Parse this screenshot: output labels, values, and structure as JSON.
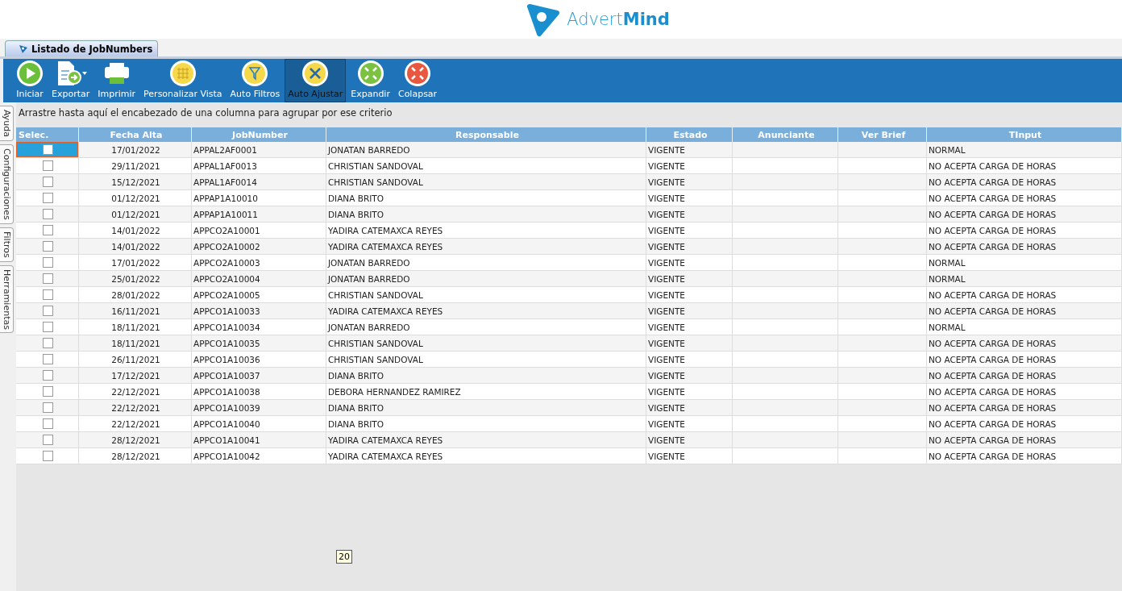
{
  "logo": {
    "text": "Advert**Mind**"
  },
  "document_tab": {
    "label": "Listado de JobNumbers",
    "selected": true
  },
  "toolbar": [
    {
      "kind": "play",
      "label": "Iniciar",
      "active": false
    },
    {
      "kind": "export",
      "label": "Exportar",
      "active": false,
      "dropdown": true
    },
    {
      "kind": "print",
      "label": "Imprimir",
      "active": false
    },
    {
      "kind": "grid",
      "label": "Personalizar Vista",
      "active": false
    },
    {
      "kind": "filter",
      "label": "Auto Filtros",
      "active": false
    },
    {
      "kind": "tools",
      "label": "Auto Ajustar",
      "active": true
    },
    {
      "kind": "expand",
      "label": "Expandir",
      "active": false
    },
    {
      "kind": "collapse",
      "label": "Colapsar",
      "active": false
    }
  ],
  "side_tabs": [
    "Ayuda",
    "Configuraciones",
    "Filtros",
    "Herramientas"
  ],
  "group_hint": "Arrastre hasta aquí el encabezado de una columna para agrupar por ese criterio",
  "table": {
    "columns": [
      "Selec.",
      "Fecha Alta",
      "JobNumber",
      "Responsable",
      "Estado",
      "Anunciante",
      "Ver Brief",
      "TInput"
    ],
    "rows": [
      {
        "selected": true,
        "checked": false,
        "cells": [
          "",
          "17/01/2022",
          "APPAL2AF0001",
          "JONATAN BARREDO",
          "VIGENTE",
          "",
          "",
          "NORMAL"
        ]
      },
      {
        "selected": false,
        "checked": false,
        "cells": [
          "",
          "29/11/2021",
          "APPAL1AF0013",
          "CHRISTIAN SANDOVAL",
          "VIGENTE",
          "",
          "",
          "NO ACEPTA CARGA DE HORAS"
        ]
      },
      {
        "selected": false,
        "checked": false,
        "cells": [
          "",
          "15/12/2021",
          "APPAL1AF0014",
          "CHRISTIAN SANDOVAL",
          "VIGENTE",
          "",
          "",
          "NO ACEPTA CARGA DE HORAS"
        ]
      },
      {
        "selected": false,
        "checked": false,
        "cells": [
          "",
          "01/12/2021",
          "APPAP1A10010",
          "DIANA BRITO",
          "VIGENTE",
          "",
          "",
          "NO ACEPTA CARGA DE HORAS"
        ]
      },
      {
        "selected": false,
        "checked": false,
        "cells": [
          "",
          "01/12/2021",
          "APPAP1A10011",
          "DIANA BRITO",
          "VIGENTE",
          "",
          "",
          "NO ACEPTA CARGA DE HORAS"
        ]
      },
      {
        "selected": false,
        "checked": false,
        "cells": [
          "",
          "14/01/2022",
          "APPCO2A10001",
          "YADIRA CATEMAXCA REYES",
          "VIGENTE",
          "",
          "",
          "NO ACEPTA CARGA DE HORAS"
        ]
      },
      {
        "selected": false,
        "checked": false,
        "cells": [
          "",
          "14/01/2022",
          "APPCO2A10002",
          "YADIRA CATEMAXCA REYES",
          "VIGENTE",
          "",
          "",
          "NO ACEPTA CARGA DE HORAS"
        ]
      },
      {
        "selected": false,
        "checked": false,
        "cells": [
          "",
          "17/01/2022",
          "APPCO2A10003",
          "JONATAN BARREDO",
          "VIGENTE",
          "",
          "",
          "NORMAL"
        ]
      },
      {
        "selected": false,
        "checked": false,
        "cells": [
          "",
          "25/01/2022",
          "APPCO2A10004",
          "JONATAN BARREDO",
          "VIGENTE",
          "",
          "",
          "NORMAL"
        ]
      },
      {
        "selected": false,
        "checked": false,
        "cells": [
          "",
          "28/01/2022",
          "APPCO2A10005",
          "CHRISTIAN SANDOVAL",
          "VIGENTE",
          "",
          "",
          "NO ACEPTA CARGA DE HORAS"
        ]
      },
      {
        "selected": false,
        "checked": false,
        "cells": [
          "",
          "16/11/2021",
          "APPCO1A10033",
          "YADIRA CATEMAXCA REYES",
          "VIGENTE",
          "",
          "",
          "NO ACEPTA CARGA DE HORAS"
        ]
      },
      {
        "selected": false,
        "checked": false,
        "cells": [
          "",
          "18/11/2021",
          "APPCO1A10034",
          "JONATAN BARREDO",
          "VIGENTE",
          "",
          "",
          "NORMAL"
        ]
      },
      {
        "selected": false,
        "checked": false,
        "cells": [
          "",
          "18/11/2021",
          "APPCO1A10035",
          "CHRISTIAN SANDOVAL",
          "VIGENTE",
          "",
          "",
          "NO ACEPTA CARGA DE HORAS"
        ]
      },
      {
        "selected": false,
        "checked": false,
        "cells": [
          "",
          "26/11/2021",
          "APPCO1A10036",
          "CHRISTIAN SANDOVAL",
          "VIGENTE",
          "",
          "",
          "NO ACEPTA CARGA DE HORAS"
        ]
      },
      {
        "selected": false,
        "checked": false,
        "cells": [
          "",
          "17/12/2021",
          "APPCO1A10037",
          "DIANA BRITO",
          "VIGENTE",
          "",
          "",
          "NO ACEPTA CARGA DE HORAS"
        ]
      },
      {
        "selected": false,
        "checked": false,
        "cells": [
          "",
          "22/12/2021",
          "APPCO1A10038",
          "DEBORA HERNANDEZ RAMIREZ",
          "VIGENTE",
          "",
          "",
          "NO ACEPTA CARGA DE HORAS"
        ]
      },
      {
        "selected": false,
        "checked": false,
        "cells": [
          "",
          "22/12/2021",
          "APPCO1A10039",
          "DIANA BRITO",
          "VIGENTE",
          "",
          "",
          "NO ACEPTA CARGA DE HORAS"
        ]
      },
      {
        "selected": false,
        "checked": false,
        "cells": [
          "",
          "22/12/2021",
          "APPCO1A10040",
          "DIANA BRITO",
          "VIGENTE",
          "",
          "",
          "NO ACEPTA CARGA DE HORAS"
        ]
      },
      {
        "selected": false,
        "checked": false,
        "cells": [
          "",
          "28/12/2021",
          "APPCO1A10041",
          "YADIRA CATEMAXCA REYES",
          "VIGENTE",
          "",
          "",
          "NO ACEPTA CARGA DE HORAS"
        ]
      },
      {
        "selected": false,
        "checked": false,
        "cells": [
          "",
          "28/12/2021",
          "APPCO1A10042",
          "YADIRA CATEMAXCA REYES",
          "VIGENTE",
          "",
          "",
          "NO ACEPTA CARGA DE HORAS"
        ]
      }
    ]
  },
  "row_count": "20"
}
